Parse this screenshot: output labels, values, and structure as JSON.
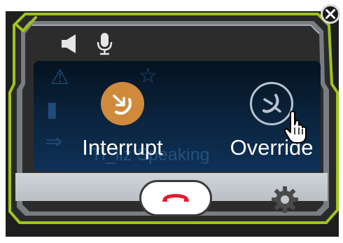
{
  "window": {
    "actions": [
      {
        "id": "interrupt",
        "label": "Interrupt",
        "icon": "interrupt-icon"
      },
      {
        "id": "override",
        "label": "Override",
        "icon": "override-icon"
      }
    ],
    "background_text": "Tl_liz Speaking"
  },
  "toolbar": {
    "speaker_icon": "speaker-icon",
    "mic_icon": "microphone-icon"
  },
  "controls": {
    "hangup_icon": "hangup-icon",
    "settings_icon": "gear-icon",
    "close_icon": "close-icon",
    "check_icon": "check-icon"
  },
  "colors": {
    "frame_outline": "#9fc31d",
    "frame_dark": "#2b2b2b",
    "frame_bevel": "#8d9297",
    "panel": "#0b2540",
    "interrupt_accent": "#d08a3b",
    "hangup_red": "#e01e2e"
  }
}
